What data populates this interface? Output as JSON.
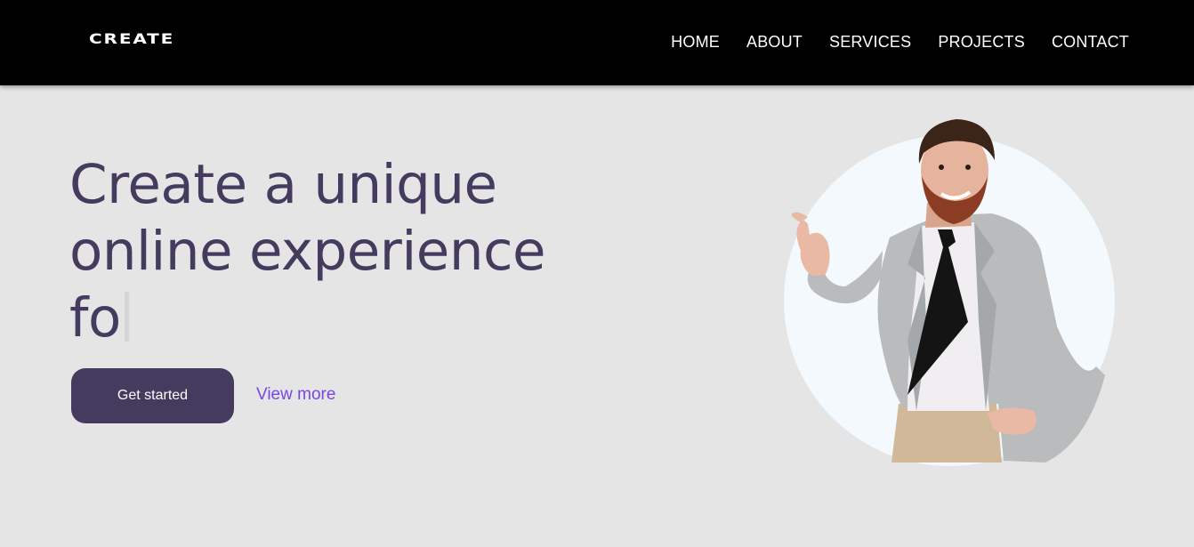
{
  "header": {
    "logo": "CREATE",
    "nav": [
      {
        "label": "HOME"
      },
      {
        "label": "ABOUT"
      },
      {
        "label": "SERVICES"
      },
      {
        "label": "PROJECTS"
      },
      {
        "label": "CONTACT"
      }
    ]
  },
  "hero": {
    "headline_line1": "Create a unique",
    "headline_line2": "online experience",
    "headline_typed": "fo",
    "primary_button": "Get started",
    "secondary_link": "View more"
  },
  "icons": {
    "portrait": "man-in-suit-pointing-photo"
  },
  "colors": {
    "nav_background": "#000000",
    "page_background": "#e5e5e5",
    "headline": "#443b5e",
    "primary_button": "#453b5f",
    "link": "#7a44e6",
    "circle": "#f3f9fc"
  }
}
